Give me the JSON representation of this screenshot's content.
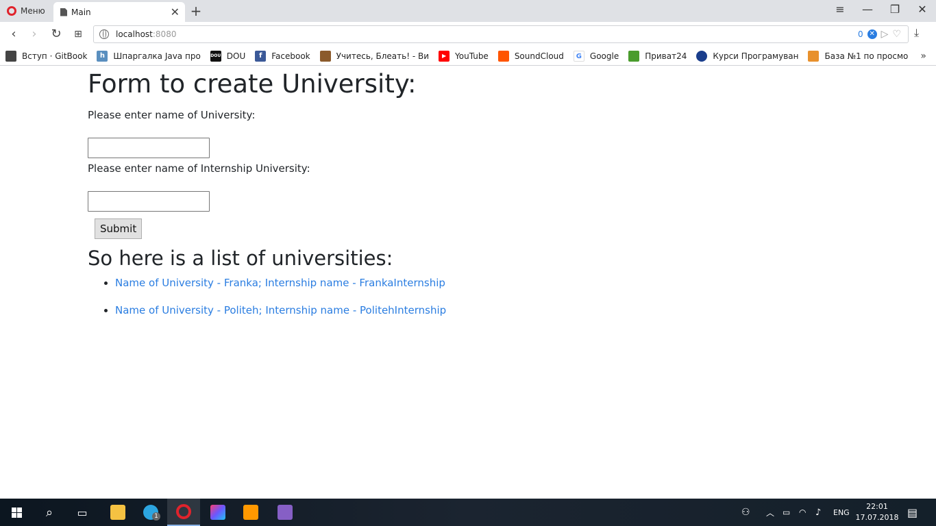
{
  "browser": {
    "menu_label": "Меню",
    "tab_title": "Main",
    "url_host": "localhost",
    "url_port": ":8080",
    "adblock_count": "0"
  },
  "bookmarks": [
    {
      "label": "Вступ · GitBook",
      "icon": "book-icon",
      "color": "#444444"
    },
    {
      "label": "Шпаргалка Java про",
      "icon": "h-icon",
      "color": "#5a8fbf"
    },
    {
      "label": "DOU",
      "icon": "dou-icon",
      "color": "#111111"
    },
    {
      "label": "Facebook",
      "icon": "facebook-icon",
      "color": "#3b5998"
    },
    {
      "label": "Учитесь, Блеать! - Ви",
      "icon": "cow-icon",
      "color": "#8b5a2b"
    },
    {
      "label": "YouTube",
      "icon": "youtube-icon",
      "color": "#ff0000"
    },
    {
      "label": "SoundCloud",
      "icon": "soundcloud-icon",
      "color": "#ff5500"
    },
    {
      "label": "Google",
      "icon": "google-icon",
      "color": "#4285f4"
    },
    {
      "label": "Приват24",
      "icon": "privat-icon",
      "color": "#4a9c2d"
    },
    {
      "label": "Курси Програмуван",
      "icon": "course-icon",
      "color": "#1a3e8c"
    },
    {
      "label": "База №1 по просмо",
      "icon": "tiger-icon",
      "color": "#e8912d"
    }
  ],
  "page": {
    "heading": "Form to create University:",
    "university_label": "Please enter name of University:",
    "university_value": "",
    "internship_label": "Please enter name of Internship University:",
    "internship_value": "",
    "submit_label": "Submit",
    "list_heading": "So here is a list of universities:",
    "universities": [
      "Name of University - Franka; Internship name - FrankaInternship",
      "Name of University - Politeh; Internship name - PolitehInternship"
    ]
  },
  "taskbar": {
    "language": "ENG",
    "time": "22:01",
    "date": "17.07.2018",
    "telegram_badge": "1"
  }
}
